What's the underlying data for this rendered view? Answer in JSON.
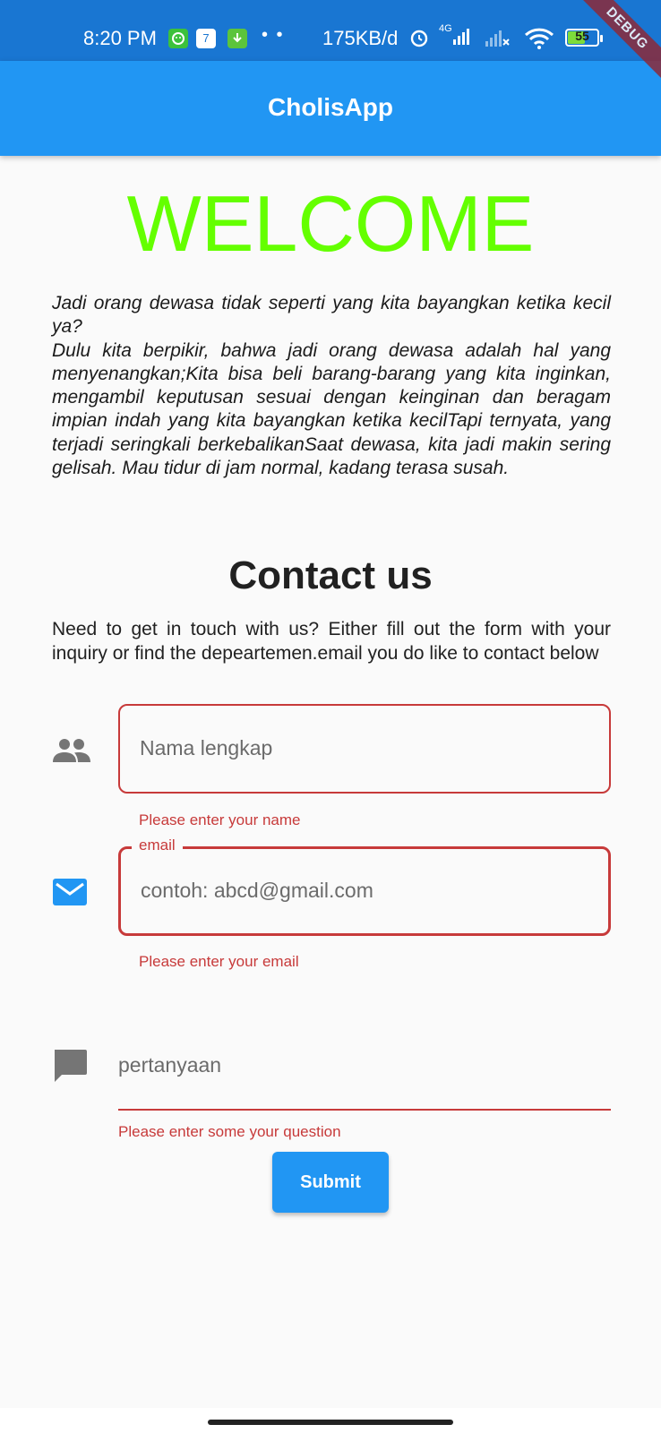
{
  "status_bar": {
    "time": "8:20 PM",
    "notification_icons": [
      "gamepad-icon",
      "calendar-icon",
      "download-icon"
    ],
    "calendar_day": "7",
    "more_dots": "• •",
    "network_speed": "175KB/d",
    "signal_label": "4G",
    "battery_percent": "55"
  },
  "debug_banner": "DEBUG",
  "app_bar": {
    "title": "CholisApp"
  },
  "welcome": "WELCOME",
  "story": {
    "line1": "Jadi orang dewasa tidak seperti yang kita bayangkan ketika kecil ya?",
    "line2": "Dulu kita berpikir, bahwa jadi orang dewasa adalah hal yang menyenangkan;Kita bisa beli barang-barang yang kita inginkan, mengambil keputusan sesuai dengan keinginan dan beragam impian indah yang kita bayangkan ketika kecilTapi ternyata, yang terjadi seringkali berkebalikanSaat dewasa, kita jadi makin sering gelisah. Mau tidur di jam normal, kadang terasa susah."
  },
  "contact": {
    "title": "Contact us",
    "description": "Need to get in touch with us? Either fill out the form with your inquiry or find the depeartemen.email you do like to contact below"
  },
  "form": {
    "name_field": {
      "placeholder": "Nama lengkap",
      "error": "Please enter your name",
      "icon": "people-icon"
    },
    "email_field": {
      "label": "email",
      "placeholder": "contoh: abcd@gmail.com",
      "error": "Please enter your email",
      "icon": "mail-icon"
    },
    "question_field": {
      "placeholder": "pertanyaan",
      "error": "Please enter some your question",
      "icon": "comment-icon"
    },
    "submit_label": "Submit"
  },
  "colors": {
    "app_bar": "#2196f3",
    "status_bar": "#1976d2",
    "welcome": "#64ff00",
    "error": "#c73a3a",
    "mail_icon": "#2196f3"
  }
}
